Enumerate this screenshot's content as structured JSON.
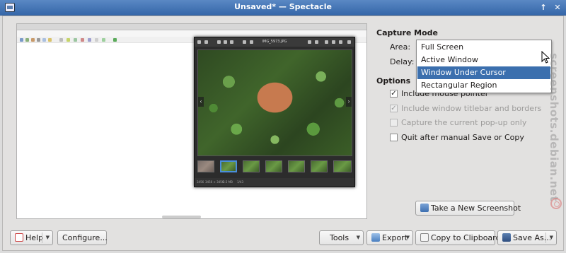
{
  "window": {
    "title": "Unsaved* — Spectacle"
  },
  "preview": {
    "viewer_title": "IMG_5973.JPG",
    "viewer_status": [
      "3456",
      "3456 × 3456",
      "3.5 MB",
      "1/43"
    ]
  },
  "capture_mode": {
    "heading": "Capture Mode",
    "area_label": "Area:",
    "delay_label": "Delay:",
    "area_options": [
      "Full Screen",
      "Active Window",
      "Window Under Cursor",
      "Rectangular Region"
    ],
    "highlighted_option": "Window Under Cursor"
  },
  "options": {
    "heading": "Options",
    "items": [
      {
        "label": "Include mouse pointer",
        "checked": true,
        "enabled": true
      },
      {
        "label": "Include window titlebar and borders",
        "checked": true,
        "enabled": false
      },
      {
        "label": "Capture the current pop-up only",
        "checked": false,
        "enabled": false
      },
      {
        "label": "Quit after manual Save or Copy",
        "checked": false,
        "enabled": true
      }
    ]
  },
  "buttons": {
    "take_screenshot": "Take a New Screenshot",
    "help": "Help",
    "configure": "Configure...",
    "tools": "Tools",
    "export": "Export",
    "copy": "Copy to Clipboard",
    "save_as": "Save As..."
  },
  "watermark": {
    "text": "screenshots.debian.net"
  },
  "icons": {
    "app": "spectacle-icon",
    "keep_above": "arrow-up-icon",
    "close": "close-icon",
    "cursor": "mouse-cursor-icon"
  },
  "colors": {
    "titlebar": "#3d6fb0",
    "highlight": "#3b6fae"
  }
}
